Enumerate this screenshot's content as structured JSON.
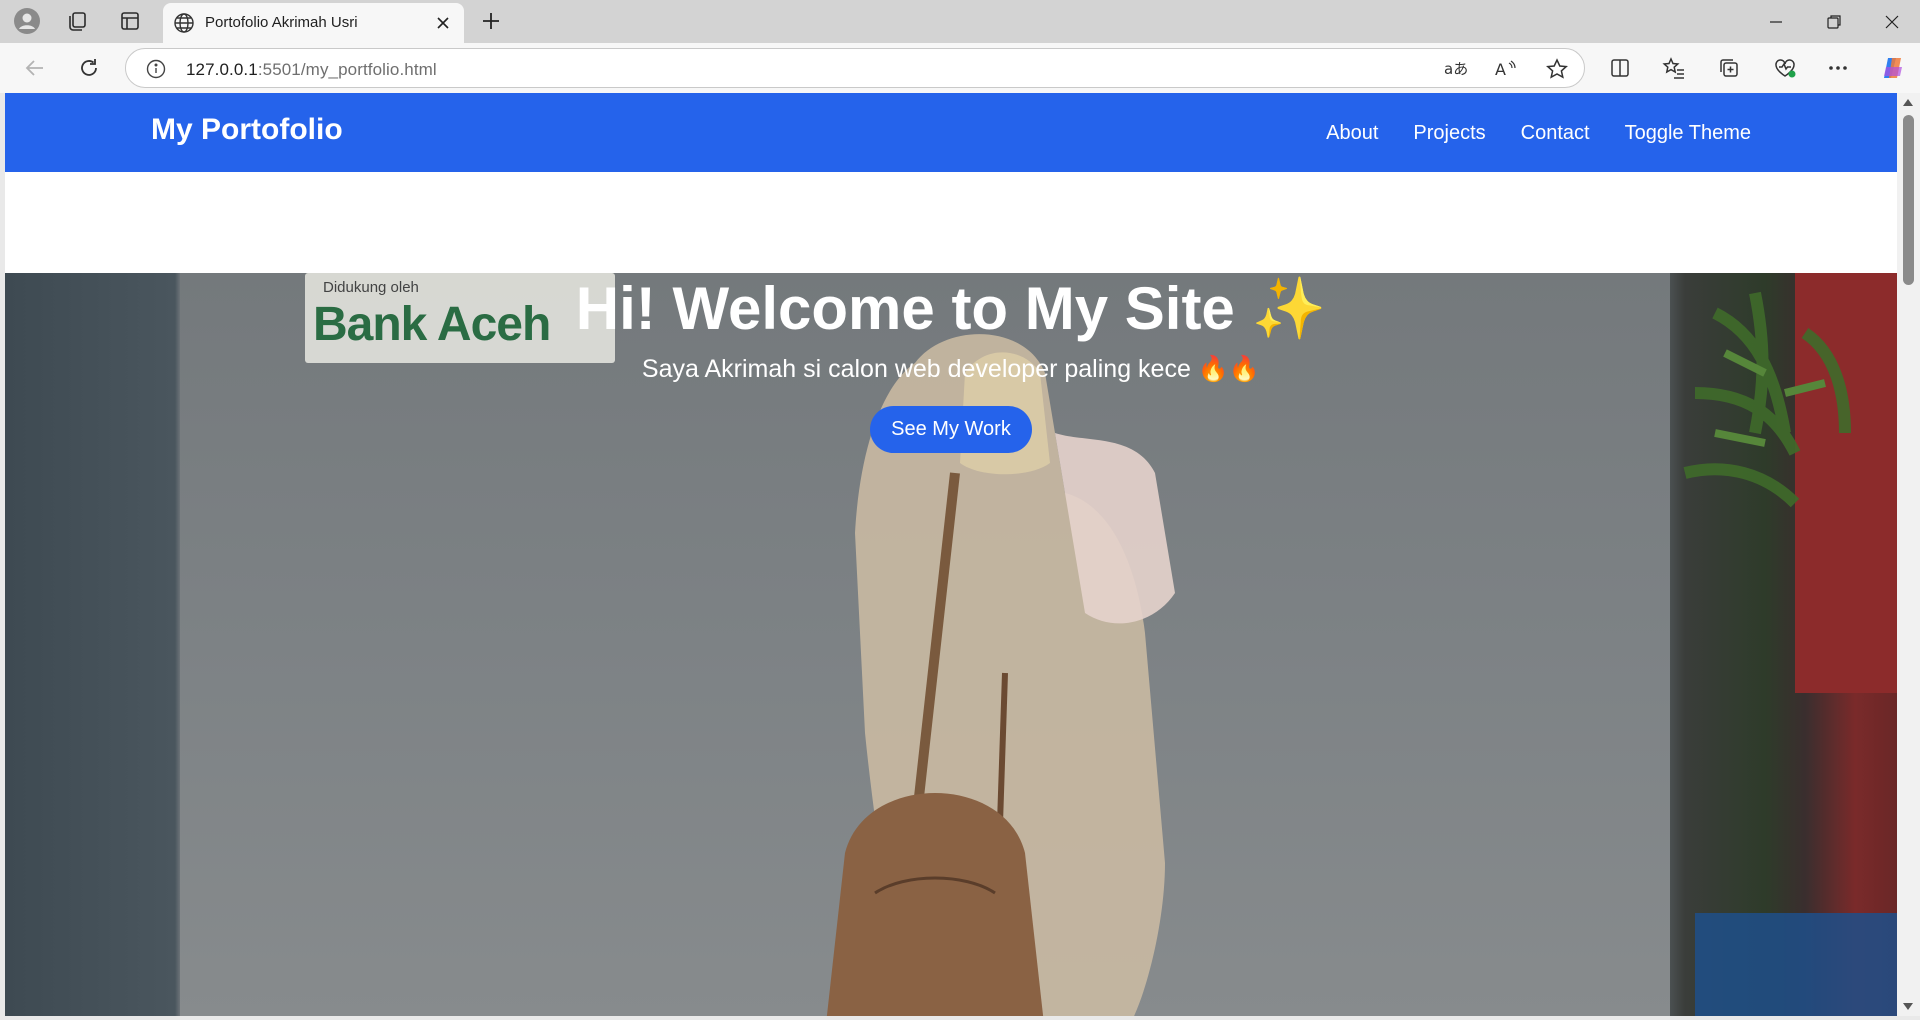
{
  "browser": {
    "tab": {
      "title": "Portofolio Akrimah Usri"
    },
    "address": {
      "host": "127.0.0.1",
      "path": ":5501/my_portfolio.html"
    }
  },
  "site": {
    "navbar": {
      "brand": "My Portofolio",
      "links": [
        "About",
        "Projects",
        "Contact",
        "Toggle Theme"
      ],
      "color": "#2563eb"
    },
    "hero": {
      "background_sign": {
        "small": "Didukung oleh",
        "big": "Bank Aceh"
      },
      "title": "Hi! Welcome to My Site ✨",
      "subtitle": "Saya Akrimah si calon web developer paling kece 🔥🔥",
      "button": "See My Work"
    }
  },
  "icons": [
    "profile-icon",
    "workspaces-icon",
    "tab-actions-icon",
    "globe-icon",
    "close-icon",
    "new-tab-icon",
    "minimize-icon",
    "restore-icon",
    "window-close-icon",
    "back-icon",
    "refresh-icon",
    "info-icon",
    "translate-icon",
    "read-aloud-icon",
    "favorite-star-icon",
    "split-screen-icon",
    "favorites-icon",
    "collections-icon",
    "browser-essentials-icon",
    "more-icon",
    "copilot-icon"
  ]
}
